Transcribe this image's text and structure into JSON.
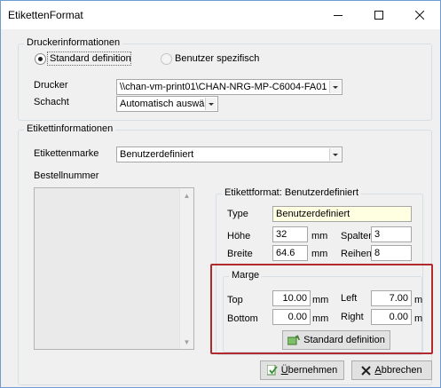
{
  "window": {
    "title": "EtikettenFormat"
  },
  "drucker_info": {
    "legend": "Druckerinformationen",
    "radio_standard": "Standard definition",
    "radio_user": "Benutzer spezifisch",
    "drucker_label": "Drucker",
    "drucker_value": "\\\\chan-vm-print01\\CHAN-NRG-MP-C6004-FA01",
    "schacht_label": "Schacht",
    "schacht_value": "Automatisch auswähl"
  },
  "etiketten_info": {
    "legend": "Etikettinformationen",
    "marke_label": "Etikettenmarke",
    "marke_value": "Benutzerdefiniert",
    "bestellnummer_label": "Bestellnummer"
  },
  "format": {
    "legend": "Etikettformat: Benutzerdefiniert",
    "type_label": "Type",
    "type_value": "Benutzerdefiniert",
    "hoehe_label": "Höhe",
    "hoehe_value": "32",
    "hoehe_unit": "mm",
    "spalten_label": "Spalten",
    "spalten_value": "3",
    "breite_label": "Breite",
    "breite_value": "64.6",
    "breite_unit": "mm",
    "reihen_label": "Reihen",
    "reihen_value": "8"
  },
  "marge": {
    "legend": "Marge",
    "top_label": "Top",
    "top_value": "10.00",
    "top_unit": "mm",
    "left_label": "Left",
    "left_value": "7.00",
    "left_unit": "m",
    "bottom_label": "Bottom",
    "bottom_value": "0.00",
    "bottom_unit": "mm",
    "right_label": "Right",
    "right_value": "0.00",
    "right_unit": "m",
    "standard_button": "Standard definition"
  },
  "buttons": {
    "apply_prefix": "Ü",
    "apply_rest": "bernehmen",
    "cancel_prefix": "A",
    "cancel_rest": "bbrechen"
  }
}
